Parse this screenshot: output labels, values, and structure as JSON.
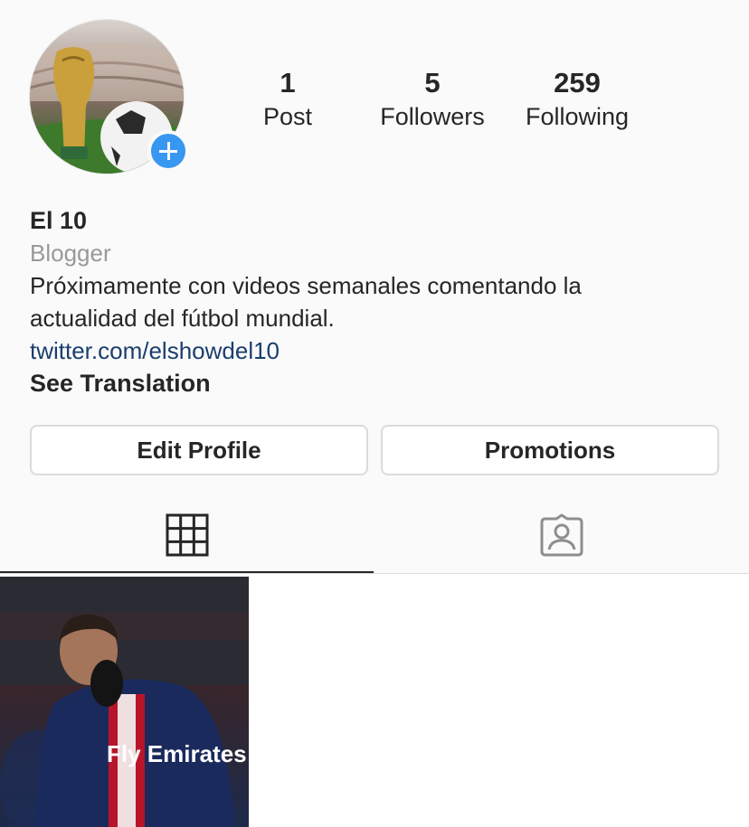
{
  "profile": {
    "stats": {
      "posts": {
        "count": "1",
        "label": "Post"
      },
      "followers": {
        "count": "5",
        "label": "Followers"
      },
      "following": {
        "count": "259",
        "label": "Following"
      }
    },
    "name": "El 10",
    "category": "Blogger",
    "bio_line1": "Próximamente con videos semanales comentando la",
    "bio_line2": "actualidad del fútbol mundial.",
    "link": "twitter.com/elshowdel10",
    "see_translation": "See Translation"
  },
  "buttons": {
    "edit_profile": "Edit Profile",
    "promotions": "Promotions"
  },
  "tabs": [
    {
      "name": "grid",
      "icon": "grid-icon",
      "active": true
    },
    {
      "name": "tagged",
      "icon": "tagged-user-icon",
      "active": false
    }
  ],
  "posts": [
    {
      "image": "football-player-photo",
      "jersey_text": "Fly Emirates"
    }
  ],
  "colors": {
    "accent_blue": "#3897f0",
    "link_blue": "#1a3e6e",
    "secondary_text": "#999999",
    "border": "#dbdbdb"
  }
}
